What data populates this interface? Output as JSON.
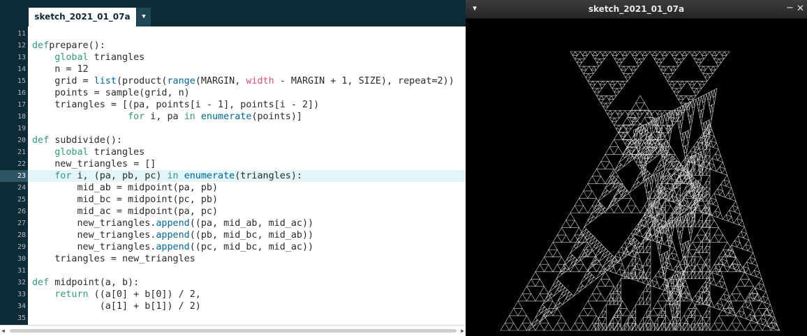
{
  "editor": {
    "tab_label": "sketch_2021_01_07a",
    "tab_menu_glyph": "▼",
    "current_line": 23,
    "scroll_left_glyph": "◀",
    "scroll_right_glyph": "▶",
    "lines": [
      {
        "n": "11",
        "segs": []
      },
      {
        "n": "12",
        "segs": [
          [
            "kw",
            "def"
          ],
          [
            "",
            "prepare():"
          ]
        ]
      },
      {
        "n": "13",
        "segs": [
          [
            "",
            "    "
          ],
          [
            "kw",
            "global"
          ],
          [
            "",
            " triangles"
          ]
        ]
      },
      {
        "n": "14",
        "segs": [
          [
            "",
            "    n = 12"
          ]
        ]
      },
      {
        "n": "15",
        "segs": [
          [
            "",
            "    grid = "
          ],
          [
            "bi",
            "list"
          ],
          [
            "",
            "(product("
          ],
          [
            "bi",
            "range"
          ],
          [
            "",
            "(MARGIN, "
          ],
          [
            "vr",
            "width"
          ],
          [
            "",
            " - MARGIN + 1, SIZE), repeat=2))"
          ]
        ]
      },
      {
        "n": "16",
        "segs": [
          [
            "",
            "    points = sample(grid, n)"
          ]
        ]
      },
      {
        "n": "17",
        "segs": [
          [
            "",
            "    triangles = [(pa, points[i - 1], points[i - 2])"
          ]
        ]
      },
      {
        "n": "18",
        "segs": [
          [
            "",
            "                 "
          ],
          [
            "kw",
            "for"
          ],
          [
            "",
            " i, pa "
          ],
          [
            "kw",
            "in"
          ],
          [
            "",
            " "
          ],
          [
            "bi",
            "enumerate"
          ],
          [
            "",
            "(points)]"
          ]
        ]
      },
      {
        "n": "19",
        "segs": []
      },
      {
        "n": "20",
        "segs": [
          [
            "kw",
            "def"
          ],
          [
            "",
            " subdivide():"
          ]
        ]
      },
      {
        "n": "21",
        "segs": [
          [
            "",
            "    "
          ],
          [
            "kw",
            "global"
          ],
          [
            "",
            " triangles"
          ]
        ]
      },
      {
        "n": "22",
        "segs": [
          [
            "",
            "    new_triangles = []"
          ]
        ]
      },
      {
        "n": "23",
        "segs": [
          [
            "",
            "    "
          ],
          [
            "kw",
            "for"
          ],
          [
            "",
            " i, (pa, pb, pc) "
          ],
          [
            "kw",
            "in"
          ],
          [
            "",
            " "
          ],
          [
            "bi",
            "enumerate"
          ],
          [
            "",
            "(triangles):"
          ]
        ]
      },
      {
        "n": "24",
        "segs": [
          [
            "",
            "        mid_ab = midpoint(pa, pb)"
          ]
        ]
      },
      {
        "n": "25",
        "segs": [
          [
            "",
            "        mid_bc = midpoint(pc, pb)"
          ]
        ]
      },
      {
        "n": "26",
        "segs": [
          [
            "",
            "        mid_ac = midpoint(pa, pc)"
          ]
        ]
      },
      {
        "n": "27",
        "segs": [
          [
            "",
            "        new_triangles."
          ],
          [
            "bi",
            "append"
          ],
          [
            "",
            "((pa, mid_ab, mid_ac))"
          ]
        ]
      },
      {
        "n": "28",
        "segs": [
          [
            "",
            "        new_triangles."
          ],
          [
            "bi",
            "append"
          ],
          [
            "",
            "((pb, mid_bc, mid_ab))"
          ]
        ]
      },
      {
        "n": "29",
        "segs": [
          [
            "",
            "        new_triangles."
          ],
          [
            "bi",
            "append"
          ],
          [
            "",
            "((pc, mid_bc, mid_ac))"
          ]
        ]
      },
      {
        "n": "30",
        "segs": [
          [
            "",
            "    triangles = new_triangles"
          ]
        ]
      },
      {
        "n": "31",
        "segs": []
      },
      {
        "n": "32",
        "segs": [
          [
            "kw",
            "def"
          ],
          [
            "",
            " midpoint(a, b):"
          ]
        ]
      },
      {
        "n": "33",
        "segs": [
          [
            "",
            "    "
          ],
          [
            "kw",
            "return"
          ],
          [
            "",
            " ((a[0] + b[0]) / 2,"
          ]
        ]
      },
      {
        "n": "34",
        "segs": [
          [
            "",
            "            (a[1] + b[1]) / 2)"
          ]
        ]
      },
      {
        "n": "35",
        "segs": []
      }
    ]
  },
  "sketch_window": {
    "title": "sketch_2021_01_07a",
    "menu_glyph": "▼",
    "minimize_glyph": "−",
    "close_glyph": "✕",
    "stroke_color": "#ffffff",
    "background": "#000000"
  },
  "colors": {
    "keyword": "#33997e",
    "builtin": "#006699",
    "variable": "#d94a7a",
    "dark_chrome": "#0d2b36"
  }
}
